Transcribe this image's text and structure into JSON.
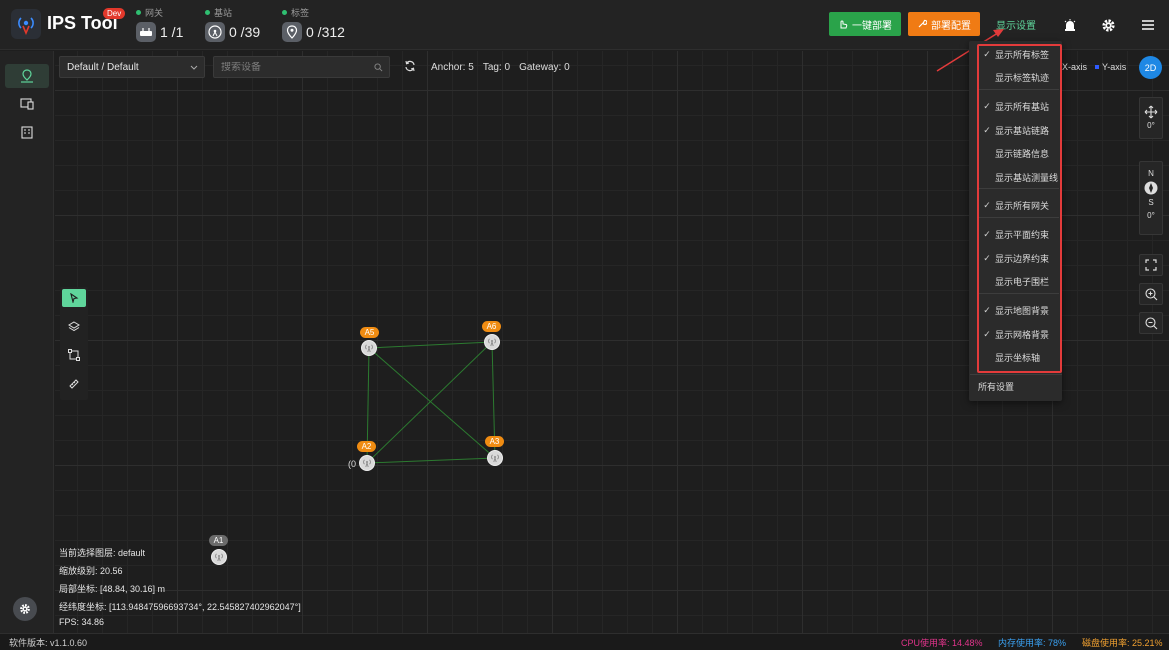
{
  "header": {
    "title": "IPS Tool",
    "badge": "Dev",
    "stats": [
      {
        "label": "网关",
        "value": "1 /1"
      },
      {
        "label": "基站",
        "value": "0 /39"
      },
      {
        "label": "标签",
        "value": "0 /312"
      }
    ],
    "deploy_button": "一键部署",
    "config_button": "部署配置",
    "display_settings": "显示设置"
  },
  "toolbar": {
    "layer_select": "Default / Default",
    "search_placeholder": "搜索设备",
    "anchor": "Anchor: 5",
    "tag": "Tag: 0",
    "gateway": "Gateway: 0",
    "x_axis": "X-axis",
    "y_axis": "Y-axis",
    "view_mode": "2D"
  },
  "right_controls": {
    "rotation": "0°",
    "north": "N",
    "south": "S",
    "heading": "0°"
  },
  "nodes": [
    {
      "label": "A5"
    },
    {
      "label": "A6"
    },
    {
      "label": "A2"
    },
    {
      "label": "A3"
    },
    {
      "label": "A1"
    }
  ],
  "node_a2_suffix": "(0",
  "info": {
    "layer": "当前选择图层:  default",
    "zoom": "缩放级别:  20.56",
    "local": "局部坐标:  [48.84, 30.16] m",
    "geo": "经纬度坐标:  [113.94847596693734°, 22.545827402962047°]",
    "fps": "FPS:  34.86"
  },
  "dropdown": {
    "items": [
      {
        "label": "显示所有标签",
        "checked": true
      },
      {
        "label": "显示标签轨迹",
        "checked": false
      },
      {
        "label": "显示所有基站",
        "checked": true
      },
      {
        "label": "显示基站链路",
        "checked": true
      },
      {
        "label": "显示链路信息",
        "checked": false
      },
      {
        "label": "显示基站测量线",
        "checked": false
      },
      {
        "label": "显示所有网关",
        "checked": true
      },
      {
        "label": "显示平面约束",
        "checked": true
      },
      {
        "label": "显示边界约束",
        "checked": true
      },
      {
        "label": "显示电子围栏",
        "checked": false
      },
      {
        "label": "显示地图背景",
        "checked": true
      },
      {
        "label": "显示网格背景",
        "checked": true
      },
      {
        "label": "显示坐标轴",
        "checked": false
      }
    ],
    "all_settings": "所有设置"
  },
  "footer": {
    "version": "软件版本: v1.1.0.60",
    "cpu": "CPU使用率: 14.48%",
    "mem": "内存使用率: 78%",
    "disk": "磁盘使用率: 25.21%"
  },
  "colors": {
    "accent_green": "#2aa34a",
    "accent_orange": "#f07b14",
    "highlight_red": "#e33b3b",
    "cpu": "#e0348b",
    "mem": "#3aa0f0",
    "disk": "#f0a030"
  }
}
